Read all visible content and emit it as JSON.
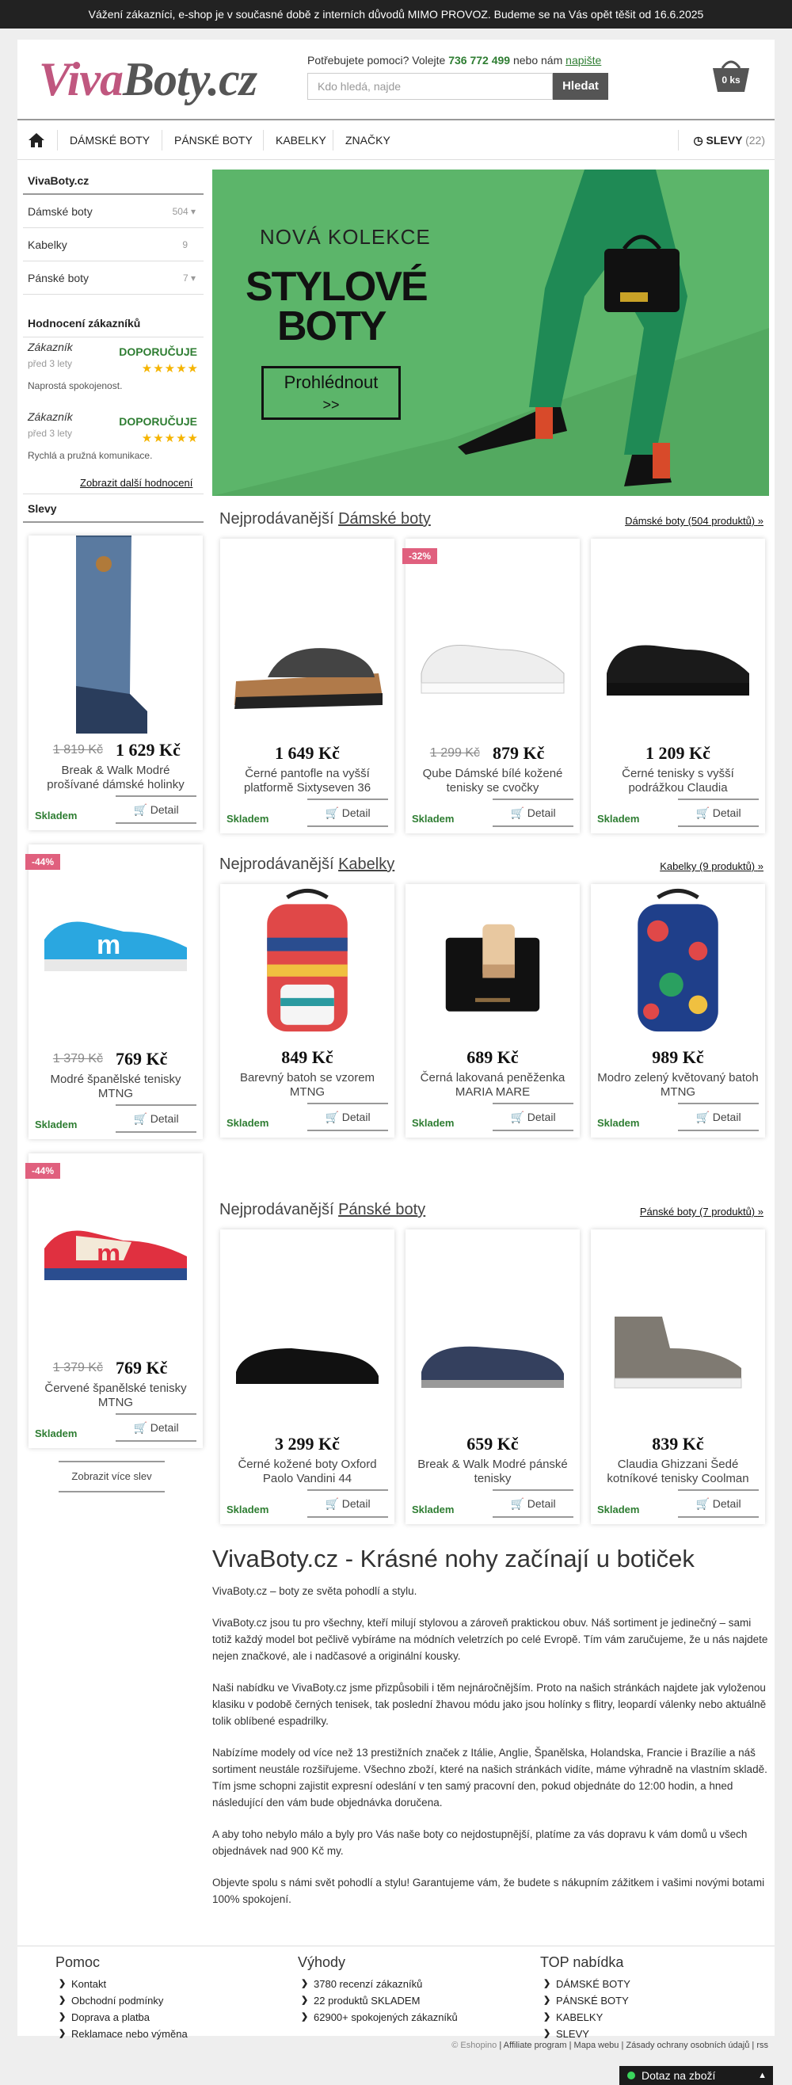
{
  "topbar": {
    "text": "Vážení zákazníci, e-shop je v současné době z interních důvodů MIMO PROVOZ. Budeme se na Vás opět těšit od 16.6.2025"
  },
  "header": {
    "logo_part1": "Viva",
    "logo_part2": "Boty.cz",
    "help_prefix": "Potřebujete pomoci? Volejte",
    "phone": "736 772 499",
    "help_middle": "nebo nám",
    "write_link": "napište",
    "search_placeholder": "Kdo hledá, najde",
    "search_button": "Hledat",
    "cart_label": "0 ks"
  },
  "nav": {
    "home_icon": "home-icon",
    "items": [
      "DÁMSKÉ BOTY",
      "PÁNSKÉ BOTY",
      "KABELKY",
      "ZNAČKY"
    ],
    "sale_label": "SLEVY",
    "sale_count": "(22)"
  },
  "sidebar": {
    "shop_title": "VivaBoty.cz",
    "categories": [
      {
        "label": "Dámské boty",
        "count": "504"
      },
      {
        "label": "Kabelky",
        "count": "9"
      },
      {
        "label": "Pánské boty",
        "count": "7"
      }
    ],
    "reviews_title": "Hodnocení zákazníků",
    "reviews": [
      {
        "name": "Zákazník",
        "ago": "před 3 lety",
        "rec": "DOPORUČUJE",
        "text": "Naprostá spokojenost."
      },
      {
        "name": "Zákazník",
        "ago": "před 3 lety",
        "rec": "DOPORUČUJE",
        "text": "Rychlá a pružná komunikace."
      }
    ],
    "more_reviews": "Zobrazit další hodnocení",
    "sale_title": "Slevy",
    "more_sale": "Zobrazit více slev"
  },
  "hero": {
    "kicker": "NOVÁ KOLEKCE",
    "line1": "STYLOVÉ",
    "line2": "BOTY",
    "button_line1": "Prohlédnout",
    "button_line2": ">>"
  },
  "sections": [
    {
      "prefix": "Nejprodávanější",
      "name": "Dámské boty",
      "link": "Dámské boty (504 produktů)"
    },
    {
      "prefix": "Nejprodávanější",
      "name": "Kabelky",
      "link": "Kabelky (9 produktů)"
    },
    {
      "prefix": "Nejprodávanější",
      "name": "Pánské boty",
      "link": "Pánské boty (7 produktů)"
    }
  ],
  "common": {
    "stock": "Skladem",
    "detail": "Detail"
  },
  "sale_products": [
    {
      "name": "Break & Walk Modré prošívané dámské holinky",
      "old": "1 819 Kč",
      "price": "1 629 Kč",
      "badge": ""
    },
    {
      "name": "Modré španělské tenisky MTNG",
      "old": "1 379 Kč",
      "price": "769 Kč",
      "badge": "-44%"
    },
    {
      "name": "Červené španělské tenisky MTNG",
      "old": "1 379 Kč",
      "price": "769 Kč",
      "badge": "-44%"
    }
  ],
  "women_products": [
    {
      "name": "Černé pantofle na vyšší platformě Sixtyseven 36",
      "old": "",
      "price": "1 649 Kč",
      "badge": ""
    },
    {
      "name": "Qube Dámské bílé kožené tenisky se cvočky",
      "old": "1 299 Kč",
      "price": "879 Kč",
      "badge": "-32%"
    },
    {
      "name": "Černé tenisky s vyšší podrážkou Claudia",
      "old": "",
      "price": "1 209 Kč",
      "badge": ""
    }
  ],
  "bag_products": [
    {
      "name": "Barevný batoh se vzorem MTNG",
      "price": "849 Kč"
    },
    {
      "name": "Černá lakovaná peněženka MARIA MARE",
      "price": "689 Kč"
    },
    {
      "name": "Modro zelený květovaný batoh MTNG",
      "price": "989 Kč"
    }
  ],
  "men_products": [
    {
      "name": "Černé kožené boty Oxford Paolo Vandini 44",
      "price": "3 299 Kč"
    },
    {
      "name": "Break & Walk Modré pánské tenisky",
      "price": "659 Kč"
    },
    {
      "name": "Claudia Ghizzani Šedé kotníkové tenisky Coolman",
      "price": "839 Kč"
    }
  ],
  "about": {
    "title": "VivaBoty.cz - Krásné nohy začínají u botiček",
    "p1": "VivaBoty.cz – boty ze světa pohodlí a stylu.",
    "p2": "VivaBoty.cz jsou tu pro všechny, kteří milují stylovou a zároveň praktickou obuv. Náš sortiment je jedinečný – sami totiž každý model bot pečlivě vybíráme na módních veletrzích po celé Evropě. Tím vám zaručujeme, že u nás najdete nejen značkové, ale i nadčasové a originální kousky.",
    "p3": "Naši nabídku ve VivaBoty.cz jsme přizpůsobili i těm nejnáročnějším. Proto na našich stránkách najdete jak vyloženou klasiku v podobě černých tenisek, tak poslední žhavou módu jako jsou holínky s flitry, leopardí válenky nebo aktuálně tolik oblíbené espadrilky.",
    "p4": "Nabízíme modely od více než 13 prestižních značek z Itálie, Anglie, Španělska, Holandska, Francie i Brazílie a náš sortiment neustále rozšiřujeme. Všechno zboží, které na našich stránkách vidíte, máme výhradně na vlastním skladě. Tím jsme schopni zajistit expresní odeslání v ten samý pracovní den, pokud objednáte do 12:00 hodin, a hned následující den vám bude objednávka doručena.",
    "p5": "A aby toho nebylo málo a byly pro Vás naše boty co nejdostupnější, platíme za vás dopravu k vám domů u všech objednávek nad 900 Kč my.",
    "p6": "Objevte spolu s námi svět pohodlí a stylu! Garantujeme vám, že budete s nákupním zážitkem i vašimi novými botami 100% spokojení."
  },
  "footer": {
    "help": {
      "title": "Pomoc",
      "items": [
        "Kontakt",
        "Obchodní podmínky",
        "Doprava a platba",
        "Reklamace nebo výměna"
      ]
    },
    "benefits": {
      "title": "Výhody",
      "items": [
        "3780 recenzí zákazníků",
        "22 produktů SKLADEM",
        "62900+ spokojených zákazníků"
      ]
    },
    "top": {
      "title": "TOP nabídka",
      "items": [
        "DÁMSKÉ BOTY",
        "PÁNSKÉ BOTY",
        "KABELKY",
        "SLEVY"
      ]
    },
    "copyright": "© Eshopino",
    "links": [
      "Affiliate program",
      "Mapa webu",
      "Zásady ochrany osobních údajů",
      "rss"
    ]
  },
  "chat": {
    "label": "Dotaz na zboží"
  },
  "colors": {
    "accent_green": "#2e7d32",
    "logo_pink": "#c0577f",
    "sale_badge": "#e0607e",
    "hero_green": "#5cb56a"
  }
}
